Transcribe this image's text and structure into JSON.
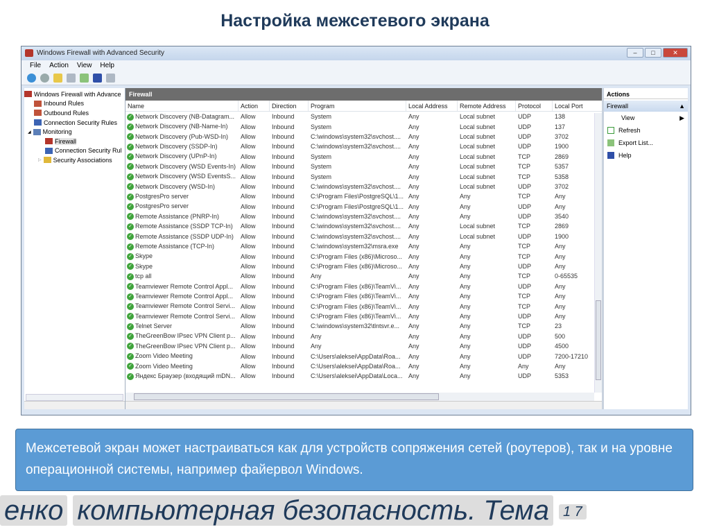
{
  "slide": {
    "title": "Настройка межсетевого экрана",
    "callout": "Межсетевой экран может настраиваться как для устройств сопряжения сетей (роутеров), так и на уровне операционной системы, например файервол Windows.",
    "footer_parts": [
      "енко",
      "компьютерная безопасность. Тема",
      "1 7"
    ]
  },
  "window": {
    "title": "Windows Firewall with Advanced Security",
    "menu": [
      "File",
      "Action",
      "View",
      "Help"
    ]
  },
  "tree": [
    "Windows Firewall with Advance",
    "Inbound Rules",
    "Outbound Rules",
    "Connection Security Rules",
    "Monitoring",
    "Firewall",
    "Connection Security Rul",
    "Security Associations"
  ],
  "center": {
    "header": "Firewall",
    "columns": [
      "Name",
      "Action",
      "Direction",
      "Program",
      "Local Address",
      "Remote Address",
      "Protocol",
      "Local Port"
    ],
    "rows": [
      [
        "Network Discovery (NB-Datagram...",
        "Allow",
        "Inbound",
        "System",
        "Any",
        "Local subnet",
        "UDP",
        "138"
      ],
      [
        "Network Discovery (NB-Name-In)",
        "Allow",
        "Inbound",
        "System",
        "Any",
        "Local subnet",
        "UDP",
        "137"
      ],
      [
        "Network Discovery (Pub-WSD-In)",
        "Allow",
        "Inbound",
        "C:\\windows\\system32\\svchost....",
        "Any",
        "Local subnet",
        "UDP",
        "3702"
      ],
      [
        "Network Discovery (SSDP-In)",
        "Allow",
        "Inbound",
        "C:\\windows\\system32\\svchost....",
        "Any",
        "Local subnet",
        "UDP",
        "1900"
      ],
      [
        "Network Discovery (UPnP-In)",
        "Allow",
        "Inbound",
        "System",
        "Any",
        "Local subnet",
        "TCP",
        "2869"
      ],
      [
        "Network Discovery (WSD Events-In)",
        "Allow",
        "Inbound",
        "System",
        "Any",
        "Local subnet",
        "TCP",
        "5357"
      ],
      [
        "Network Discovery (WSD EventsS...",
        "Allow",
        "Inbound",
        "System",
        "Any",
        "Local subnet",
        "TCP",
        "5358"
      ],
      [
        "Network Discovery (WSD-In)",
        "Allow",
        "Inbound",
        "C:\\windows\\system32\\svchost....",
        "Any",
        "Local subnet",
        "UDP",
        "3702"
      ],
      [
        "PostgresPro server",
        "Allow",
        "Inbound",
        "C:\\Program Files\\PostgreSQL\\1...",
        "Any",
        "Any",
        "TCP",
        "Any"
      ],
      [
        "PostgresPro server",
        "Allow",
        "Inbound",
        "C:\\Program Files\\PostgreSQL\\1...",
        "Any",
        "Any",
        "UDP",
        "Any"
      ],
      [
        "Remote Assistance (PNRP-In)",
        "Allow",
        "Inbound",
        "C:\\windows\\system32\\svchost....",
        "Any",
        "Any",
        "UDP",
        "3540"
      ],
      [
        "Remote Assistance (SSDP TCP-In)",
        "Allow",
        "Inbound",
        "C:\\windows\\system32\\svchost....",
        "Any",
        "Local subnet",
        "TCP",
        "2869"
      ],
      [
        "Remote Assistance (SSDP UDP-In)",
        "Allow",
        "Inbound",
        "C:\\windows\\system32\\svchost....",
        "Any",
        "Local subnet",
        "UDP",
        "1900"
      ],
      [
        "Remote Assistance (TCP-In)",
        "Allow",
        "Inbound",
        "C:\\windows\\system32\\msra.exe",
        "Any",
        "Any",
        "TCP",
        "Any"
      ],
      [
        "Skype",
        "Allow",
        "Inbound",
        "C:\\Program Files (x86)\\Microso...",
        "Any",
        "Any",
        "TCP",
        "Any"
      ],
      [
        "Skype",
        "Allow",
        "Inbound",
        "C:\\Program Files (x86)\\Microso...",
        "Any",
        "Any",
        "UDP",
        "Any"
      ],
      [
        "tcp all",
        "Allow",
        "Inbound",
        "Any",
        "Any",
        "Any",
        "TCP",
        "0-65535"
      ],
      [
        "Teamviewer Remote Control Appl...",
        "Allow",
        "Inbound",
        "C:\\Program Files (x86)\\TeamVi...",
        "Any",
        "Any",
        "UDP",
        "Any"
      ],
      [
        "Teamviewer Remote Control Appl...",
        "Allow",
        "Inbound",
        "C:\\Program Files (x86)\\TeamVi...",
        "Any",
        "Any",
        "TCP",
        "Any"
      ],
      [
        "Teamviewer Remote Control Servi...",
        "Allow",
        "Inbound",
        "C:\\Program Files (x86)\\TeamVi...",
        "Any",
        "Any",
        "TCP",
        "Any"
      ],
      [
        "Teamviewer Remote Control Servi...",
        "Allow",
        "Inbound",
        "C:\\Program Files (x86)\\TeamVi...",
        "Any",
        "Any",
        "UDP",
        "Any"
      ],
      [
        "Telnet Server",
        "Allow",
        "Inbound",
        "C:\\windows\\system32\\tlntsvr.e...",
        "Any",
        "Any",
        "TCP",
        "23"
      ],
      [
        "TheGreenBow IPsec VPN Client p...",
        "Allow",
        "Inbound",
        "Any",
        "Any",
        "Any",
        "UDP",
        "500"
      ],
      [
        "TheGreenBow IPsec VPN Client p...",
        "Allow",
        "Inbound",
        "Any",
        "Any",
        "Any",
        "UDP",
        "4500"
      ],
      [
        "Zoom Video Meeting",
        "Allow",
        "Inbound",
        "C:\\Users\\aleksei\\AppData\\Roa...",
        "Any",
        "Any",
        "UDP",
        "7200-17210"
      ],
      [
        "Zoom Video Meeting",
        "Allow",
        "Inbound",
        "C:\\Users\\aleksei\\AppData\\Roa...",
        "Any",
        "Any",
        "Any",
        "Any"
      ],
      [
        "Яндекс Браузер (входящий mDN...",
        "Allow",
        "Inbound",
        "C:\\Users\\aleksei\\AppData\\Loca...",
        "Any",
        "Any",
        "UDP",
        "5353"
      ]
    ]
  },
  "actions": {
    "header": "Actions",
    "section": "Firewall",
    "items": [
      "View",
      "Refresh",
      "Export List...",
      "Help"
    ]
  }
}
